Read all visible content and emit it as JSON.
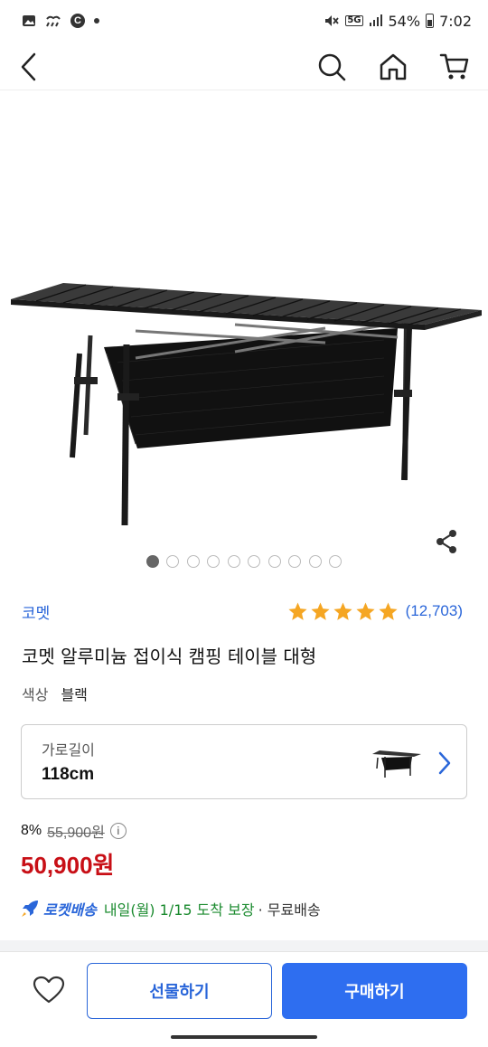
{
  "status_bar": {
    "percent": "54%",
    "time": "7:02",
    "network": "5G",
    "notification_letter": "C"
  },
  "icons": {
    "back": "chevron-left-icon",
    "search": "search-icon",
    "home": "home-icon",
    "cart": "cart-icon",
    "share": "share-icon",
    "wishlist": "heart-icon",
    "info": "info-icon",
    "rocket": "rocket-icon"
  },
  "colors": {
    "brand_blue": "#2a66d9",
    "buy_blue": "#2e6ef0",
    "sale_red": "#c80f16",
    "star_yellow": "#f5a623",
    "eta_green": "#1a8a2e"
  },
  "gallery": {
    "image_count": 10,
    "active_index": 0
  },
  "product": {
    "brand": "코멧",
    "rating": 5,
    "review_count": "(12,703)",
    "title": "코멧 알루미늄 접이식 캠핑 테이블 대형",
    "option_key": "색상",
    "option_value": "블랙"
  },
  "option_selector": {
    "label": "가로길이",
    "value": "118cm"
  },
  "price": {
    "discount": "8%",
    "original": "55,900원",
    "sale": "50,900원"
  },
  "delivery": {
    "rocket_label": "로켓배송",
    "eta": "내일(월) 1/15 도착 보장",
    "shipping": "· 무료배송"
  },
  "bottom_bar": {
    "gift_label": "선물하기",
    "buy_label": "구매하기"
  }
}
